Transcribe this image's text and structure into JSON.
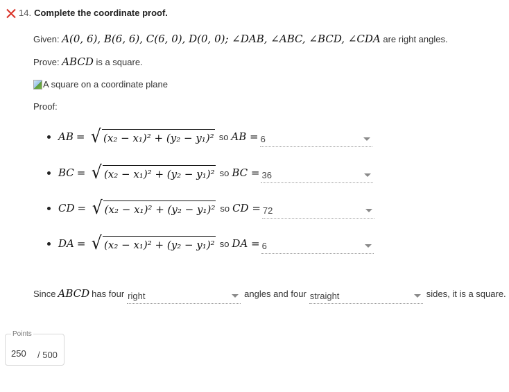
{
  "question": {
    "status_icon": "x-icon",
    "status_color": "#d93025",
    "number": "14.",
    "title": "Complete the coordinate proof."
  },
  "given": {
    "label": "Given:",
    "math": "A(0, 6), B(6, 6), C(6, 0), D(0, 0); ∠DAB, ∠ABC, ∠BCD, ∠CDA",
    "suffix": "are right angles."
  },
  "prove": {
    "label": "Prove:",
    "math": "ABCD",
    "suffix": "is a square."
  },
  "image_alt": "A square on a coordinate plane",
  "proof_label": "Proof:",
  "proof_steps": [
    {
      "segment": "AB",
      "formula": "(x₂ − x₁)² + (y₂ − y₁)²",
      "so": "so",
      "result_label": "AB =",
      "selected": "6"
    },
    {
      "segment": "BC",
      "formula": "(x₂ − x₁)² + (y₂ − y₁)²",
      "so": "so",
      "result_label": "BC =",
      "selected": "36"
    },
    {
      "segment": "CD",
      "formula": "(x₂ − x₁)² + (y₂ − y₁)²",
      "so": "so",
      "result_label": "CD =",
      "selected": "72"
    },
    {
      "segment": "DA",
      "formula": "(x₂ − x₁)² + (y₂ − y₁)²",
      "so": "so",
      "result_label": "DA =",
      "selected": "6"
    }
  ],
  "conclusion": {
    "prefix": "Since",
    "math": "ABCD",
    "part1": "has four",
    "dropdown1": "right",
    "part2": "angles and four",
    "dropdown2": "straight",
    "part3": "sides, it is a square."
  },
  "points": {
    "label": "Points",
    "value": "250",
    "max": "/ 500"
  }
}
